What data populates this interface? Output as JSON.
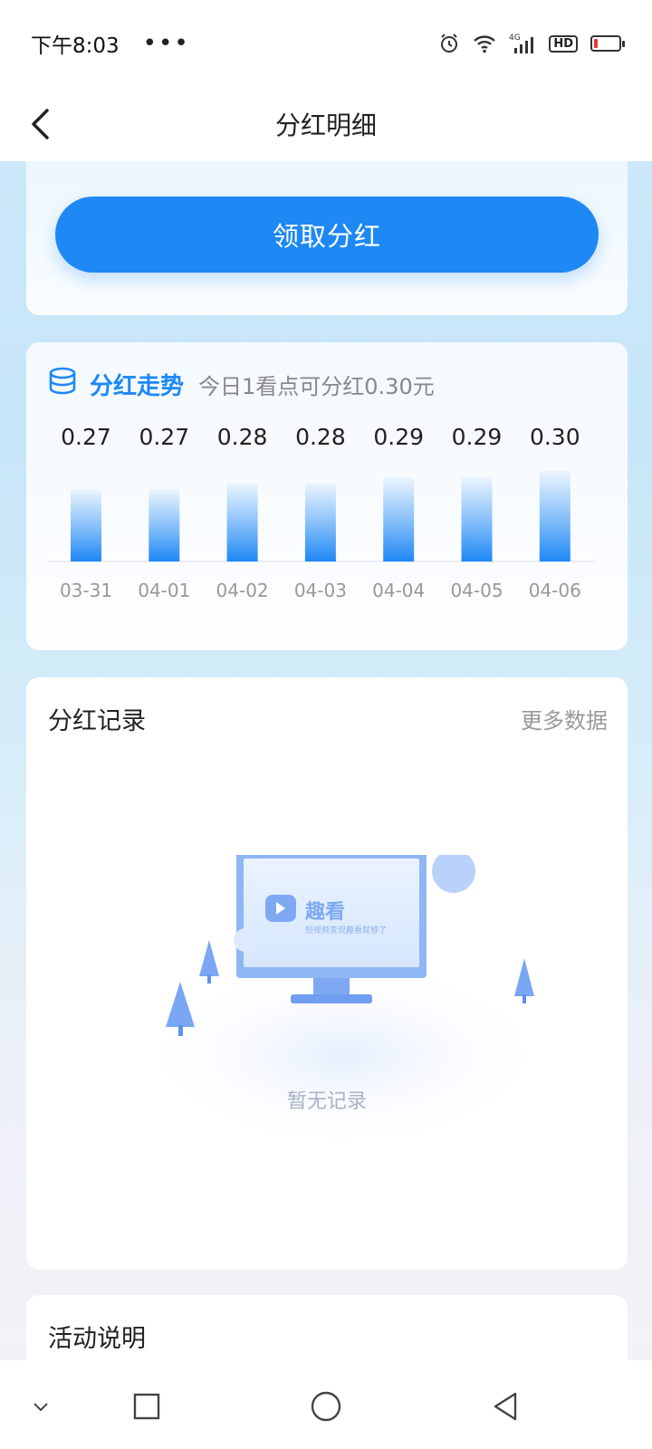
{
  "status_bar": {
    "time": "下午8:03",
    "more_dots": "•••",
    "network": "4G",
    "hd": "HD"
  },
  "nav": {
    "title": "分红明细"
  },
  "top_card": {
    "claim_button": "领取分红"
  },
  "trend": {
    "title": "分红走势",
    "subtitle": "今日1看点可分红0.30元"
  },
  "chart_data": {
    "type": "bar",
    "title": "分红走势",
    "categories": [
      "03-31",
      "04-01",
      "04-02",
      "04-03",
      "04-04",
      "04-05",
      "04-06"
    ],
    "values": [
      0.27,
      0.27,
      0.28,
      0.28,
      0.29,
      0.29,
      0.3
    ],
    "value_labels": [
      "0.27",
      "0.27",
      "0.28",
      "0.28",
      "0.29",
      "0.29",
      "0.30"
    ],
    "bar_color": "#1e88f5",
    "ylim": [
      0.24,
      0.3
    ],
    "grid": false,
    "legend": "none"
  },
  "records": {
    "title": "分红记录",
    "more_label": "更多数据",
    "empty_text": "暂无记录",
    "logo_text": "趣看",
    "logo_slogan": "短视频变现趣看就够了"
  },
  "description": {
    "title": "活动说明"
  },
  "colors": {
    "accent": "#1e88f5",
    "muted": "#999999"
  }
}
